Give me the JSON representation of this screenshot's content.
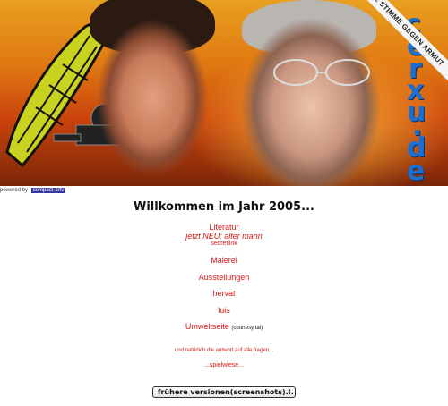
{
  "banner": {
    "site_letters": [
      "c",
      "e",
      "r",
      "x",
      "u",
      ".",
      "d",
      "e"
    ],
    "ribbon_text": "DEINE STIMME GEGEN ARMUT",
    "powered_prefix": "powered by",
    "powered_link": "compact-artv"
  },
  "main": {
    "heading": "Willkommen im Jahr 2005...",
    "nav": {
      "literatur": "Literatur",
      "jetzt_neu": "jetzt NEU:",
      "alter_mann": "alter mann",
      "secretlink": "secretlink",
      "malerei": "Malerei",
      "ausstellungen": "Ausstellungen",
      "hervat": "hervat",
      "luis": "luis",
      "umweltseite": "Umweltseite",
      "courtesy": "(courtesy tai)",
      "antwort": "und natürlich die antwort auf alle fragen...",
      "spielwiese": "...spielwiese..."
    },
    "versions_select": {
      "selected": "frühere versionen(screenshots)...",
      "arrows": "⇕"
    }
  },
  "colors": {
    "link_red": "#d21818",
    "title_blue": "#1b6fd0"
  }
}
